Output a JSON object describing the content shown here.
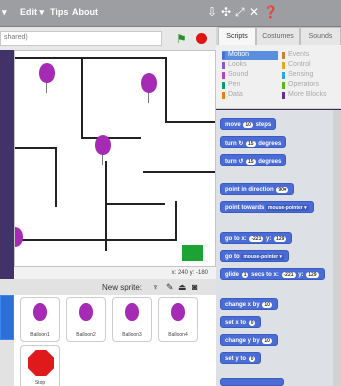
{
  "menu": {
    "edit": "Edit ▾",
    "tips": "Tips",
    "about": "About"
  },
  "project": {
    "title_fragment": "shared)"
  },
  "stage": {
    "coords": "x: 240  y: -180"
  },
  "sprites": {
    "new_sprite_label": "New sprite:",
    "items": [
      {
        "name": "Balloon1"
      },
      {
        "name": "Balloon2"
      },
      {
        "name": "Balloon3"
      },
      {
        "name": "Balloon4"
      },
      {
        "name": "Stop"
      }
    ]
  },
  "tabs": [
    "Scripts",
    "Costumes",
    "Sounds"
  ],
  "categories": {
    "left": [
      {
        "label": "Motion",
        "color": "#4a6cd4"
      },
      {
        "label": "Looks",
        "color": "#8a55d7"
      },
      {
        "label": "Sound",
        "color": "#bb42c3"
      },
      {
        "label": "Pen",
        "color": "#0e9a6c"
      },
      {
        "label": "Data",
        "color": "#ee7d16"
      }
    ],
    "right": [
      {
        "label": "Events",
        "color": "#c88330"
      },
      {
        "label": "Control",
        "color": "#e1a91a"
      },
      {
        "label": "Sensing",
        "color": "#2ca5e2"
      },
      {
        "label": "Operators",
        "color": "#5cb712"
      },
      {
        "label": "More Blocks",
        "color": "#632d99"
      }
    ]
  },
  "blocks": {
    "move": {
      "pre": "move",
      "v": "10",
      "post": "steps"
    },
    "turn_cw": {
      "pre": "turn ↻",
      "v": "15",
      "post": "degrees"
    },
    "turn_ccw": {
      "pre": "turn ↺",
      "v": "15",
      "post": "degrees"
    },
    "point_dir": {
      "pre": "point in direction",
      "v": "90▾"
    },
    "point_towards": {
      "pre": "point towards",
      "v": "mouse-pointer ▾"
    },
    "goto_xy": {
      "pre": "go to x:",
      "x": "-221",
      "mid": "y:",
      "y": "129"
    },
    "goto": {
      "pre": "go to",
      "v": "mouse-pointer ▾"
    },
    "glide": {
      "pre": "glide",
      "s": "1",
      "mid": "secs to x:",
      "x": "-221",
      "mid2": "y:",
      "y": "129"
    },
    "change_x": {
      "pre": "change x by",
      "v": "10"
    },
    "set_x": {
      "pre": "set x to",
      "v": "0"
    },
    "change_y": {
      "pre": "change y by",
      "v": "10"
    },
    "set_y": {
      "pre": "set y to",
      "v": "0"
    }
  }
}
